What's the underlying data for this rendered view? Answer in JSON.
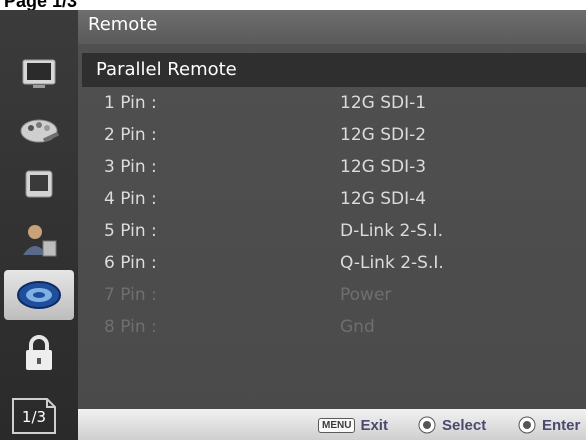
{
  "caption": {
    "text": "Page 1/3"
  },
  "sidebar": {
    "items": [
      {
        "icon": "monitor-icon"
      },
      {
        "icon": "color-palette-icon"
      },
      {
        "icon": "screen-icon"
      },
      {
        "icon": "user-settings-icon"
      },
      {
        "icon": "remote-icon",
        "active": true
      },
      {
        "icon": "lock-icon"
      }
    ],
    "page_indicator": "1/3"
  },
  "panel": {
    "title": "Remote",
    "section": "Parallel Remote",
    "rows": [
      {
        "label": "1 Pin :",
        "value": "12G SDI-1",
        "enabled": true
      },
      {
        "label": "2 Pin :",
        "value": "12G SDI-2",
        "enabled": true
      },
      {
        "label": "3 Pin :",
        "value": "12G SDI-3",
        "enabled": true
      },
      {
        "label": "4 Pin :",
        "value": "12G SDI-4",
        "enabled": true
      },
      {
        "label": "5 Pin :",
        "value": "D-Link 2-S.I.",
        "enabled": true
      },
      {
        "label": "6 Pin :",
        "value": "Q-Link 2-S.I.",
        "enabled": true
      },
      {
        "label": "7 Pin :",
        "value": "Power",
        "enabled": false
      },
      {
        "label": "8 Pin :",
        "value": "Gnd",
        "enabled": false
      }
    ]
  },
  "footer": {
    "menu_key": "MENU",
    "exit_label": "Exit",
    "select_label": "Select",
    "enter_label": "Enter"
  }
}
